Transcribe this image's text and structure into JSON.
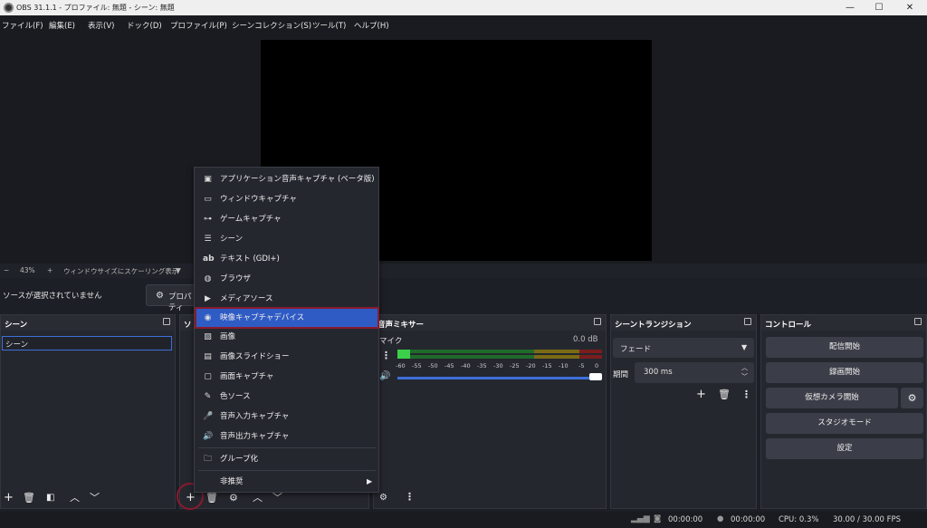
{
  "window": {
    "title": "OBS 31.1.1 - プロファイル: 無題 - シーン: 無題",
    "minimize": "—",
    "maximize": "☐",
    "close": "✕"
  },
  "menubar": [
    "ファイル(F)",
    "編集(E)",
    "表示(V)",
    "ドック(D)",
    "プロファイル(P)",
    "シーンコレクション(S)",
    "ツール(T)",
    "ヘルプ(H)"
  ],
  "zoom": {
    "minus": "−",
    "value": "43%",
    "plus": "+",
    "mode": "ウィンドウサイズにスケーリング表示",
    "dropdown": "▼"
  },
  "status_text": "ソースが選択されていません",
  "properties_button": "プロパティ",
  "scenes": {
    "title": "シーン",
    "items": [
      "シーン"
    ]
  },
  "sources": {
    "title": "ソ"
  },
  "mixer": {
    "title": "音声ミキサー",
    "track": "マイク",
    "db": "0.0 dB",
    "scale": [
      "-60",
      "-55",
      "-50",
      "-45",
      "-40",
      "-35",
      "-30",
      "-25",
      "-20",
      "-15",
      "-10",
      "-5",
      "0"
    ],
    "volume_fraction": 0.98
  },
  "transitions": {
    "title": "シーントランジション",
    "selected": "フェード",
    "duration_label": "期間",
    "duration_value": "300 ms"
  },
  "controls": {
    "title": "コントロール",
    "buttons": [
      "配信開始",
      "録画開始",
      "仮想カメラ開始",
      "スタジオモード",
      "設定"
    ]
  },
  "context_menu": {
    "items": [
      {
        "label": "アプリケーション音声キャプチャ (ベータ版)",
        "icon": "speaker-window-icon"
      },
      {
        "label": "ウィンドウキャプチャ",
        "icon": "window-icon"
      },
      {
        "label": "ゲームキャプチャ",
        "icon": "gamepad-icon"
      },
      {
        "label": "シーン",
        "icon": "list-icon"
      },
      {
        "label": "テキスト (GDI+)",
        "icon": "text-icon"
      },
      {
        "label": "ブラウザ",
        "icon": "globe-icon"
      },
      {
        "label": "メディアソース",
        "icon": "play-icon"
      },
      {
        "label": "映像キャプチャデバイス",
        "icon": "camera-icon",
        "selected": true
      },
      {
        "label": "画像",
        "icon": "image-icon"
      },
      {
        "label": "画像スライドショー",
        "icon": "slideshow-icon"
      },
      {
        "label": "画面キャプチャ",
        "icon": "monitor-icon"
      },
      {
        "label": "色ソース",
        "icon": "brush-icon"
      },
      {
        "label": "音声入力キャプチャ",
        "icon": "microphone-icon"
      },
      {
        "label": "音声出力キャプチャ",
        "icon": "speaker-icon"
      },
      {
        "label": "グループ化",
        "icon": "folder-icon"
      },
      {
        "label": "非推奨",
        "icon": "",
        "submenu": true
      }
    ]
  },
  "footer": {
    "stream_time": "00:00:00",
    "rec_time": "00:00:00",
    "cpu": "CPU: 0.3%",
    "fps": "30.00 / 30.00 FPS"
  },
  "colors": {
    "accent": "#2f5bc4",
    "highlight_outline": "#8b1a2e",
    "meter_green": "#1f6b2a",
    "meter_yellow": "#7a6a14",
    "meter_red": "#7a1d1d"
  }
}
